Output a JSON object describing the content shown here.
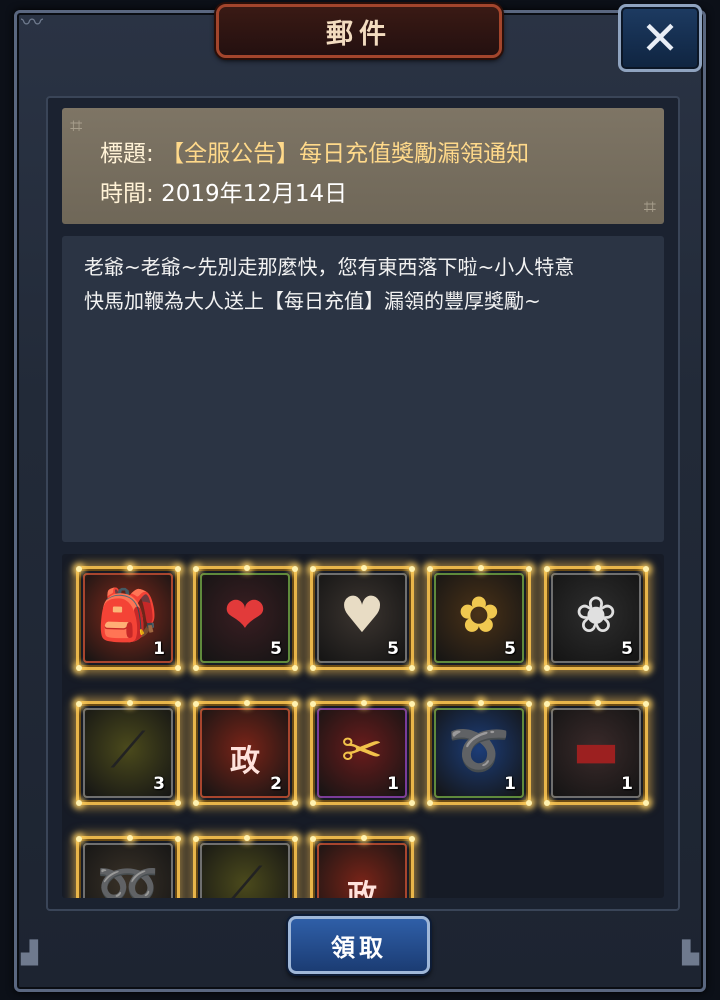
{
  "dialog": {
    "title": "郵件",
    "close_symbol": "✕"
  },
  "mail": {
    "subject_label": "標題:",
    "subject_value": "【全服公告】每日充值獎勵漏領通知",
    "time_label": "時間:",
    "time_value": "2019年12月14日",
    "body_line1": "老爺~老爺~先別走那麼快，您有東西落下啦~小人特意",
    "body_line2": "快馬加鞭為大人送上【每日充值】漏領的豐厚獎勵~"
  },
  "rewards": [
    {
      "icon": "lucky-bag-icon",
      "glyph": "🎒",
      "qty": "1",
      "bg": "#8a2b1c",
      "frame": "#a8452e"
    },
    {
      "icon": "red-heart-icon",
      "glyph": "❤",
      "qty": "5",
      "bg": "#3a1e22",
      "frame": "#5f8a3c"
    },
    {
      "icon": "jade-heart-icon",
      "glyph": "♥",
      "qty": "5",
      "bg": "#3c3530",
      "frame": "#6f6f6f"
    },
    {
      "icon": "hairpin-icon",
      "glyph": "✿",
      "qty": "5",
      "bg": "#4a3218",
      "frame": "#5f8a3c"
    },
    {
      "icon": "flower-staff-icon",
      "glyph": "❀",
      "qty": "5",
      "bg": "#2e2e2e",
      "frame": "#6f6f6f"
    },
    {
      "icon": "iron-rod-icon",
      "glyph": "⟋",
      "qty": "3",
      "bg": "#4b4a1c",
      "frame": "#6f6f6f"
    },
    {
      "icon": "red-pouch-icon",
      "glyph": "政",
      "qty": "2",
      "bg": "#7a2418",
      "frame": "#a8452e"
    },
    {
      "icon": "golden-scissors-icon",
      "glyph": "✂",
      "qty": "1",
      "bg": "#6a1c1c",
      "frame": "#7a3c9a"
    },
    {
      "icon": "whip-icon",
      "glyph": "➰",
      "qty": "1",
      "bg": "#1c3d78",
      "frame": "#5f8a3c"
    },
    {
      "icon": "red-baton-icon",
      "glyph": "▬",
      "qty": "1",
      "bg": "#3a2a2a",
      "frame": "#6f6f6f"
    },
    {
      "icon": "rope-icon",
      "glyph": "➿",
      "qty": "",
      "bg": "#3a3228",
      "frame": "#6f6f6f"
    },
    {
      "icon": "iron-rod-icon",
      "glyph": "⟋",
      "qty": "",
      "bg": "#4b4a1c",
      "frame": "#6f6f6f"
    },
    {
      "icon": "red-pouch-icon",
      "glyph": "政",
      "qty": "",
      "bg": "#7a2418",
      "frame": "#a8452e"
    }
  ],
  "claim_button_label": "領取",
  "colors": {
    "accent_gold": "#e8b54a",
    "title_tab_border": "#a3452c",
    "button_blue": "#2f5fa8"
  }
}
